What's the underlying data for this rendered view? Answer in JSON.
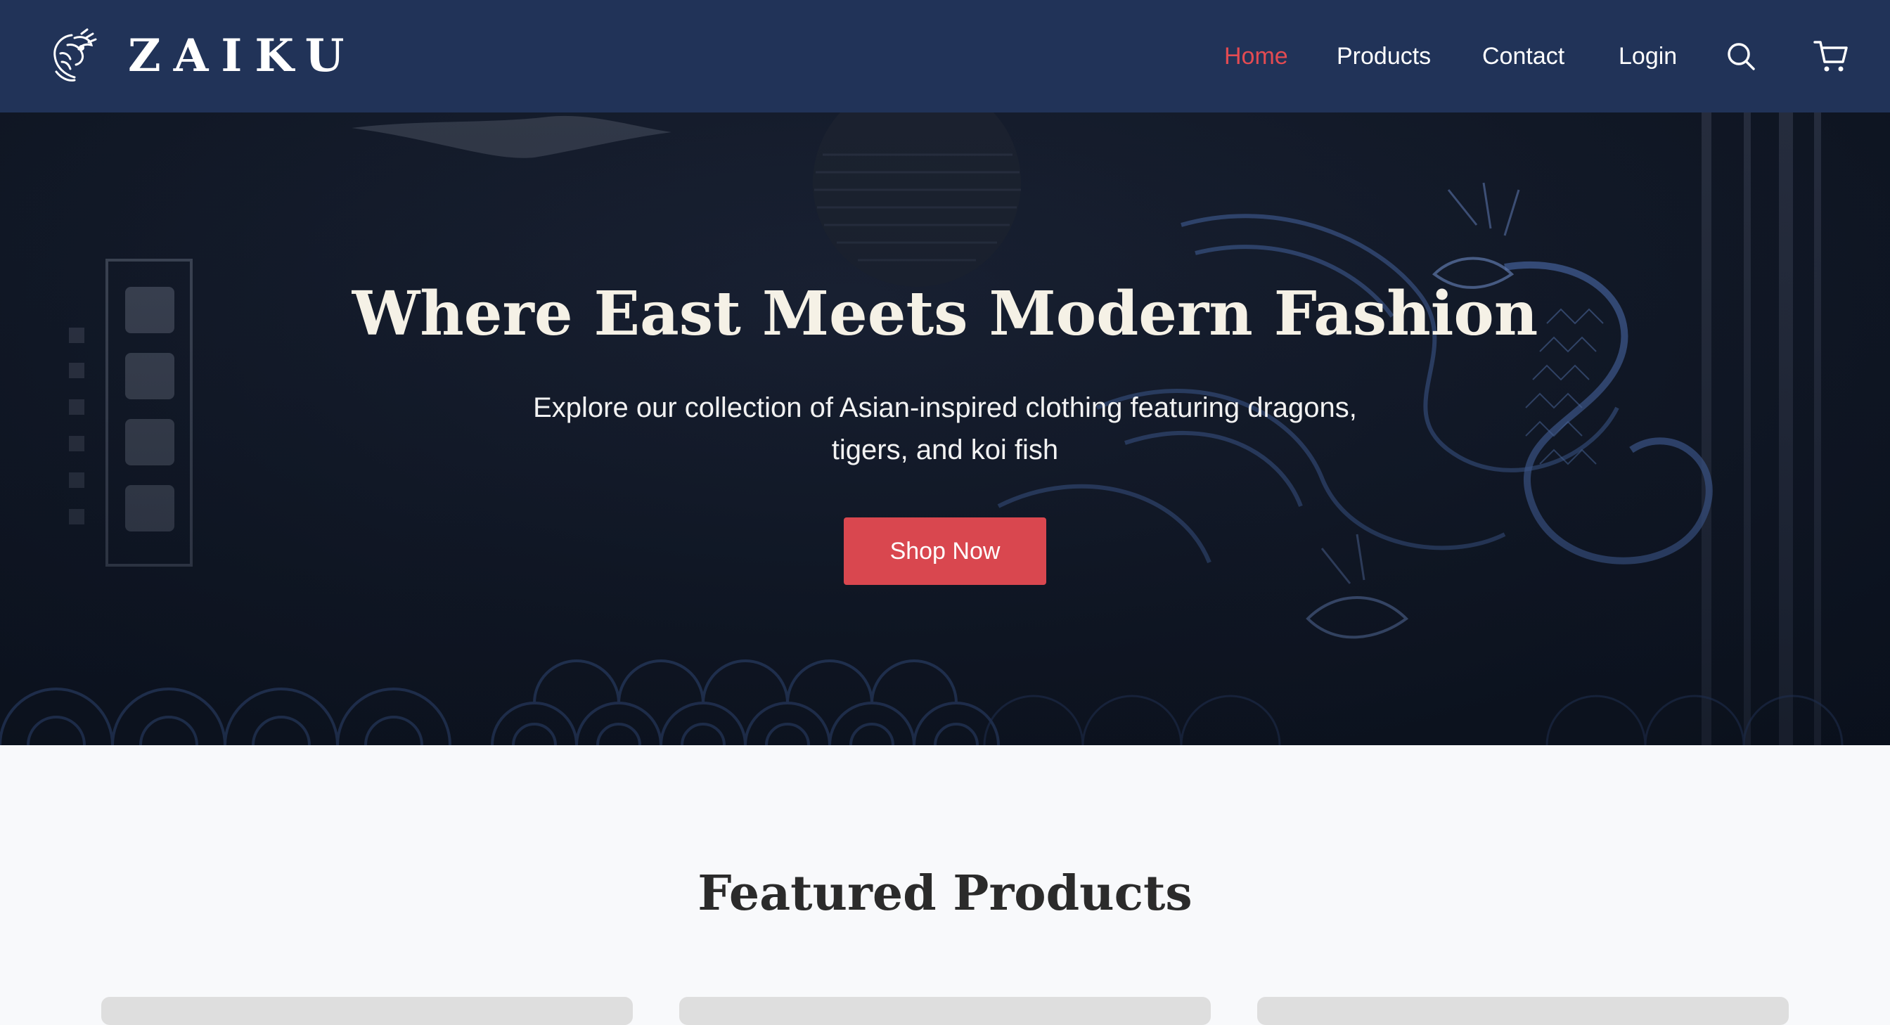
{
  "brand": {
    "name": "ZAIKU",
    "logo_icon": "dragon-logo-icon"
  },
  "nav": {
    "items": [
      {
        "label": "Home",
        "active": true
      },
      {
        "label": "Products",
        "active": false
      },
      {
        "label": "Contact",
        "active": false
      },
      {
        "label": "Login",
        "active": false
      }
    ],
    "search_icon": "search-icon",
    "cart_icon": "cart-icon"
  },
  "hero": {
    "title": "Where East Meets Modern Fashion",
    "subtitle": "Explore our collection of Asian-inspired clothing featuring dragons, tigers, and koi fish",
    "cta_label": "Shop Now",
    "background": "dragon-waves-artwork"
  },
  "featured": {
    "title": "Featured Products",
    "cards": [
      {
        "name": "product-card-1"
      },
      {
        "name": "product-card-2"
      },
      {
        "name": "product-card-3"
      }
    ]
  },
  "colors": {
    "navbar": "#213358",
    "accent": "#d9474f",
    "active_link": "#e34b52",
    "page_bg": "#f8f9fb",
    "hero_text": "#f5f1e6"
  }
}
